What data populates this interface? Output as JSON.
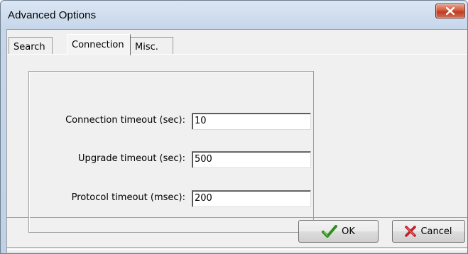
{
  "window": {
    "title": "Advanced Options",
    "close_icon": "close-x-icon",
    "accent_close": "#c7432a"
  },
  "tabs": [
    {
      "label": "Search",
      "active": false
    },
    {
      "label": "Connection",
      "active": true
    },
    {
      "label": "Misc.",
      "active": false
    }
  ],
  "connection": {
    "connection_timeout": {
      "label": "Connection timeout (sec):",
      "value": "10"
    },
    "upgrade_timeout": {
      "label": "Upgrade timeout (sec):",
      "value": "500"
    },
    "protocol_timeout": {
      "label": "Protocol timeout (msec):",
      "value": "200"
    }
  },
  "buttons": {
    "ok": {
      "label": "OK",
      "icon": "checkmark-icon",
      "color": "#2f8f1f"
    },
    "cancel": {
      "label": "Cancel",
      "icon": "red-x-icon",
      "color": "#c0202a"
    }
  }
}
